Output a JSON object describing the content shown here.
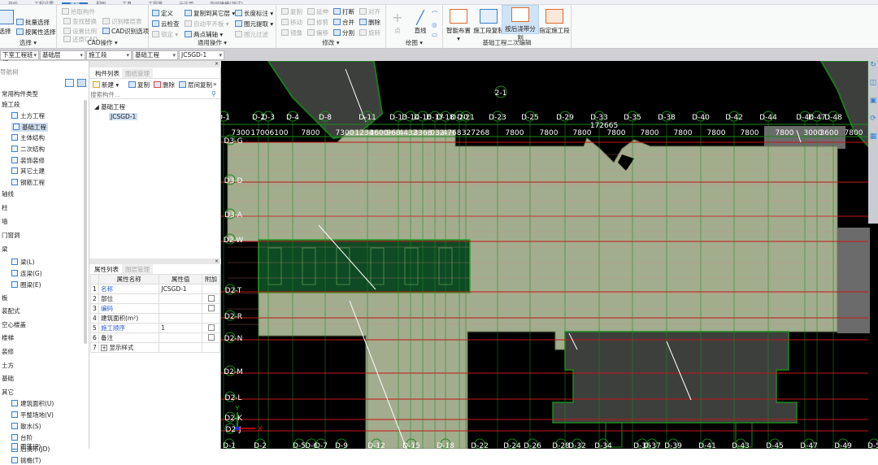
{
  "menu_tabs": [
    "开始",
    "工程设置",
    "建模",
    "视图",
    "工具",
    "工程量",
    "云应用",
    "协同建模(测试)"
  ],
  "menu_active": 2,
  "ribbon": {
    "select": {
      "label": "选择",
      "big": "选择",
      "items": [
        "批量选择",
        "按属性选择"
      ]
    },
    "cad": {
      "label": "CAD操作",
      "items": [
        "拾取构件",
        "查找替换",
        "识别楼层表",
        "设置比例",
        "CAD识别选项",
        "还原CAD"
      ]
    },
    "common": {
      "label": "通用操作",
      "items": [
        "定义",
        "复制到其它层",
        "长度标注",
        "云检查",
        "自动平齐板",
        "图元提取",
        "锁定",
        "两点辅轴",
        "图元过滤"
      ]
    },
    "modify": {
      "label": "修改",
      "items": [
        "复制",
        "延伸",
        "打断",
        "对齐",
        "移动",
        "修剪",
        "合并",
        "删除",
        "镜像",
        "偏移",
        "分割",
        "旋转"
      ]
    },
    "draw": {
      "label": "绘图",
      "items": [
        "点",
        "直线"
      ]
    },
    "foundation": {
      "label": "基础工程二次编辑",
      "items": [
        "智能布置",
        "施工段复制",
        "按后浇带分割",
        "指定施工段"
      ]
    }
  },
  "selectors": [
    "下室工程班组",
    "基础层",
    "施工段",
    "基础工程",
    "JCSGD-1"
  ],
  "nav": {
    "title": "导航树",
    "items": [
      {
        "label": "常用构件类型",
        "level": 0
      },
      {
        "label": "施工段",
        "level": 0
      },
      {
        "label": "土方工程",
        "level": 1
      },
      {
        "label": "基础工程",
        "level": 1,
        "selected": true
      },
      {
        "label": "主体结构",
        "level": 1
      },
      {
        "label": "二次结构",
        "level": 1
      },
      {
        "label": "装饰装修",
        "level": 1
      },
      {
        "label": "其它土建",
        "level": 1
      },
      {
        "label": "钢筋工程",
        "level": 1
      },
      {
        "label": "轴线",
        "level": 0
      },
      {
        "label": "柱",
        "level": 0
      },
      {
        "label": "墙",
        "level": 0
      },
      {
        "label": "门窗洞",
        "level": 0
      },
      {
        "label": "梁",
        "level": 0
      },
      {
        "label": "梁(L)",
        "level": 1
      },
      {
        "label": "连梁(G)",
        "level": 1
      },
      {
        "label": "圈梁(E)",
        "level": 1
      },
      {
        "label": "板",
        "level": 0
      },
      {
        "label": "装配式",
        "level": 0
      },
      {
        "label": "空心楼盖",
        "level": 0
      },
      {
        "label": "楼梯",
        "level": 0
      },
      {
        "label": "装修",
        "level": 0
      },
      {
        "label": "土方",
        "level": 0
      },
      {
        "label": "基础",
        "level": 0
      },
      {
        "label": "其它",
        "level": 0
      },
      {
        "label": "建筑面积(U)",
        "level": 1
      },
      {
        "label": "平整场地(V)",
        "level": 1
      },
      {
        "label": "散水(S)",
        "level": 1
      },
      {
        "label": "台阶",
        "level": 1
      },
      {
        "label": "后浇带(JD)",
        "level": 1
      },
      {
        "label": "挑檐(T)",
        "level": 1
      },
      {
        "label": "雨蓬(P)",
        "level": 1
      }
    ]
  },
  "component_list": {
    "tabs": [
      "构件列表",
      "图纸管理"
    ],
    "toolbar": [
      "新建",
      "复制",
      "删除",
      "层间复制"
    ],
    "search_placeholder": "搜索构件...",
    "tree_root": "基础工程",
    "tree_item": "JCSGD-1"
  },
  "properties": {
    "tabs": [
      "属性列表",
      "图层管理"
    ],
    "headers": [
      "属性名称",
      "属性值",
      "附加"
    ],
    "rows": [
      {
        "no": "1",
        "name": "名称",
        "value": "JCSGD-1",
        "blue": true,
        "check": false
      },
      {
        "no": "2",
        "name": "部位",
        "value": "",
        "blue": false,
        "check": true
      },
      {
        "no": "3",
        "name": "编码",
        "value": "",
        "blue": true,
        "check": true
      },
      {
        "no": "4",
        "name": "建筑面积(m²)",
        "value": "",
        "blue": false,
        "check": false
      },
      {
        "no": "5",
        "name": "施工顺序",
        "value": "1",
        "blue": true,
        "check": true
      },
      {
        "no": "6",
        "name": "备注",
        "value": "",
        "blue": false,
        "check": true
      },
      {
        "no": "7",
        "name": "显示样式",
        "value": "",
        "blue": false,
        "check": false,
        "expand": "+"
      }
    ]
  },
  "canvas": {
    "top_axes": [
      "D-1",
      "D-2",
      "D-3",
      "D-4",
      "D-8",
      "D-11",
      "D-13",
      "D-14",
      "D-16",
      "D-17",
      "D-18",
      "D-20",
      "D-21",
      "D-23",
      "D-25",
      "D-29",
      "D-33",
      "D-35",
      "D-38",
      "D-40",
      "D-42",
      "D-44",
      "D-46",
      "D-47",
      "D-48"
    ],
    "dimensions": [
      "7300",
      "1700",
      "6100",
      "7800",
      "7300",
      "1234",
      "3600",
      "968",
      "4432",
      "3368",
      "032",
      "4768",
      "327268",
      "7800",
      "7800",
      "7800",
      "7800",
      "7800",
      "7800",
      "7800",
      "7800",
      "7800",
      "3000",
      "3600",
      "7800"
    ],
    "top_note": "172665",
    "marker": "2-1",
    "left_axes": [
      "D3-G",
      "D3-D",
      "D3-A",
      "D2-W",
      "D2-T",
      "D2-R",
      "D2-N",
      "D2-M",
      "D2-L",
      "D2-K",
      "D2-J"
    ],
    "bottom_axes": [
      "D-1",
      "D-2",
      "D-5",
      "D-6",
      "D-7",
      "D-9",
      "D-12",
      "D-15",
      "D-18",
      "D-22",
      "D-24",
      "D-26",
      "D-28",
      "D-32",
      "D-34",
      "D-36",
      "D-37",
      "D-39",
      "D-41",
      "D-43",
      "D-45",
      "D-47",
      "D-49",
      "D-5"
    ],
    "ucs": {
      "x": "X",
      "y": "Y"
    },
    "colors": {
      "background": "#000000",
      "slab": "#a2ad8e",
      "selected_block": "#0e4a23",
      "raft": "#3d3f3d",
      "grid_red": "#c81414",
      "axis_green": "#1e8a1e",
      "gray_zone": "#6b6b6b"
    }
  }
}
